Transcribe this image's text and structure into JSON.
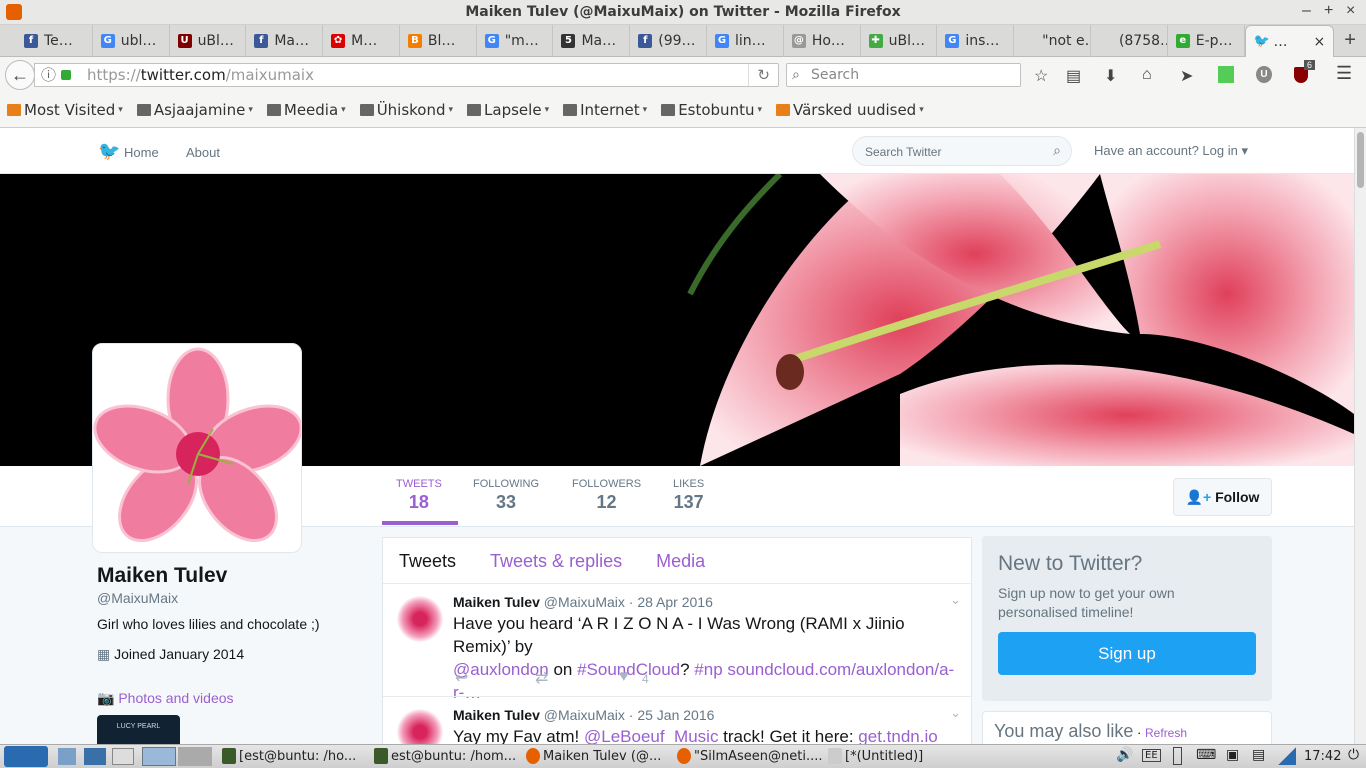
{
  "window": {
    "title": "Maiken Tulev (@MaixuMaix) on Twitter - Mozilla Firefox"
  },
  "tabs": [
    {
      "label": "Te…",
      "icon": "facebook-icon",
      "color": "#3b5998",
      "glyph": "f"
    },
    {
      "label": "ubl…",
      "icon": "google-icon",
      "color": "#4285f4",
      "glyph": "G"
    },
    {
      "label": "uBl…",
      "icon": "ublock-icon",
      "color": "#800000",
      "glyph": "U"
    },
    {
      "label": "Ma…",
      "icon": "facebook-icon",
      "color": "#3b5998",
      "glyph": "f"
    },
    {
      "label": "M…",
      "icon": "huawei-icon",
      "color": "#d00",
      "glyph": "✿"
    },
    {
      "label": "Bl…",
      "icon": "blogger-icon",
      "color": "#f57d00",
      "glyph": "B"
    },
    {
      "label": "\"m…",
      "icon": "google-icon",
      "color": "#4285f4",
      "glyph": "G"
    },
    {
      "label": "Ma…",
      "icon": "site-icon",
      "color": "#333",
      "glyph": "5"
    },
    {
      "label": "(99…",
      "icon": "facebook-icon",
      "color": "#3b5998",
      "glyph": "f"
    },
    {
      "label": "lin…",
      "icon": "google-icon",
      "color": "#4285f4",
      "glyph": "G"
    },
    {
      "label": "Ho…",
      "icon": "site-icon",
      "color": "#999",
      "glyph": "@"
    },
    {
      "label": "uBl…",
      "icon": "puzzle-icon",
      "color": "#4a4",
      "glyph": "✚"
    },
    {
      "label": "ins…",
      "icon": "google-icon",
      "color": "#4285f4",
      "glyph": "G"
    },
    {
      "label": "\"not e…",
      "icon": "none",
      "color": "transparent",
      "glyph": ""
    },
    {
      "label": "(8758…",
      "icon": "none",
      "color": "transparent",
      "glyph": ""
    },
    {
      "label": "E-p…",
      "icon": "site-icon",
      "color": "#3a3",
      "glyph": "e"
    }
  ],
  "active_tab": {
    "label": "…",
    "close": "×"
  },
  "navbar": {
    "url_scheme": "https://",
    "url_host": "twitter.com",
    "url_path": "/maixumaix",
    "search_placeholder": "Search",
    "ublock_badge": "6"
  },
  "bookmarks": [
    {
      "label": "Most Visited"
    },
    {
      "label": "Asjaajamine"
    },
    {
      "label": "Meedia"
    },
    {
      "label": "Ühiskond"
    },
    {
      "label": "Lapsele"
    },
    {
      "label": "Internet"
    },
    {
      "label": "Estobuntu"
    },
    {
      "label": "Värsked uudised"
    }
  ],
  "twitter_nav": {
    "home": "Home",
    "about": "About",
    "search_placeholder": "Search Twitter",
    "login": "Have an account? Log in"
  },
  "stats": [
    {
      "label": "TWEETS",
      "value": "18"
    },
    {
      "label": "FOLLOWING",
      "value": "33"
    },
    {
      "label": "FOLLOWERS",
      "value": "12"
    },
    {
      "label": "LIKES",
      "value": "137"
    }
  ],
  "follow_label": "Follow",
  "profile": {
    "name": "Maiken Tulev",
    "handle": "@MaixuMaix",
    "bio": "Girl who loves lilies and chocolate ;)",
    "joined": "Joined January 2014",
    "photos": "Photos and videos",
    "thumb_text": "LUCY PEARL"
  },
  "timeline_tabs": [
    "Tweets",
    "Tweets & replies",
    "Media"
  ],
  "tweets": [
    {
      "name": "Maiken Tulev",
      "handle": "@MaixuMaix",
      "date": "· 28 Apr 2016",
      "text1": "Have you heard ‘A R I Z O N A - I Was Wrong (RAMI x Jiinio Remix)’ by",
      "mention": "@auxlondon",
      "on": " on ",
      "tag1": "#SoundCloud",
      "q": "? ",
      "tag2": "#np",
      "link": " soundcloud.com/auxlondon/a-r-…",
      "likes": "4"
    },
    {
      "name": "Maiken Tulev",
      "handle": "@MaixuMaix",
      "date": "· 25 Jan 2016",
      "pre": "Yay my Fav atm! ",
      "mention": "@LeBoeuf_Music",
      "mid": " track! Get it here: ",
      "link": "get.tndn.io"
    }
  ],
  "signup": {
    "title": "New to Twitter?",
    "text": "Sign up now to get your own personalised timeline!",
    "button": "Sign up"
  },
  "also_like": {
    "title": "You may also like",
    "dot": "·",
    "refresh": "Refresh"
  },
  "taskbar": {
    "items": [
      "[est@buntu: /ho...",
      "est@buntu: /hom...",
      "Maiken Tulev (@...",
      "\"SilmAseen@neti....",
      "[*(Untitled)]"
    ],
    "clock": "17:42"
  },
  "colors": {
    "twitter_blue": "#1da1f2",
    "link_purple": "#9a5fd0"
  }
}
